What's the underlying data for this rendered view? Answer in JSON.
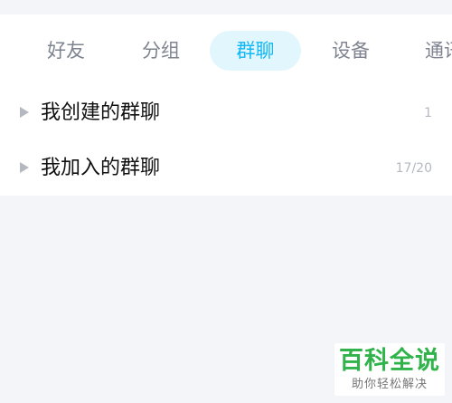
{
  "tabs": [
    {
      "label": "好友",
      "active": false
    },
    {
      "label": "分组",
      "active": false
    },
    {
      "label": "群聊",
      "active": true
    },
    {
      "label": "设备",
      "active": false
    },
    {
      "label": "通讯",
      "active": false
    }
  ],
  "groups": [
    {
      "name": "我创建的群聊",
      "count": "1",
      "icon": "expand-triangle-icon"
    },
    {
      "name": "我加入的群聊",
      "count": "17/20",
      "icon": "expand-triangle-icon"
    }
  ],
  "watermark": {
    "title": "百科全说",
    "subtitle": "助你轻松解决"
  },
  "colors": {
    "accent": "#12b7f5",
    "active_tab_bg": "#e2f6fd",
    "inactive_tab": "#7f8491",
    "page_bg": "#f4f5f9",
    "watermark_green": "#2fb34a"
  }
}
